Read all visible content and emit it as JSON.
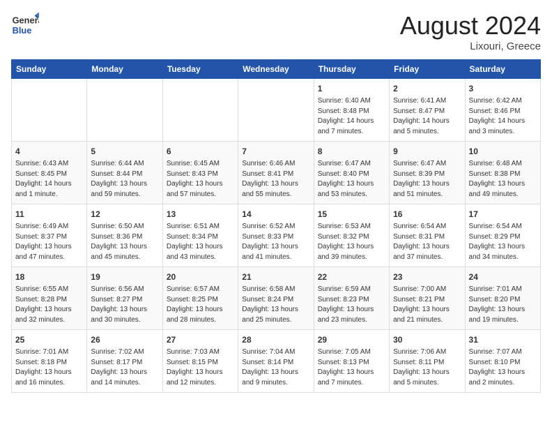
{
  "header": {
    "logo_general": "General",
    "logo_blue": "Blue",
    "month_year": "August 2024",
    "location": "Lixouri, Greece"
  },
  "weekdays": [
    "Sunday",
    "Monday",
    "Tuesday",
    "Wednesday",
    "Thursday",
    "Friday",
    "Saturday"
  ],
  "weeks": [
    [
      {
        "day": "",
        "info": ""
      },
      {
        "day": "",
        "info": ""
      },
      {
        "day": "",
        "info": ""
      },
      {
        "day": "",
        "info": ""
      },
      {
        "day": "1",
        "info": "Sunrise: 6:40 AM\nSunset: 8:48 PM\nDaylight: 14 hours\nand 7 minutes."
      },
      {
        "day": "2",
        "info": "Sunrise: 6:41 AM\nSunset: 8:47 PM\nDaylight: 14 hours\nand 5 minutes."
      },
      {
        "day": "3",
        "info": "Sunrise: 6:42 AM\nSunset: 8:46 PM\nDaylight: 14 hours\nand 3 minutes."
      }
    ],
    [
      {
        "day": "4",
        "info": "Sunrise: 6:43 AM\nSunset: 8:45 PM\nDaylight: 14 hours\nand 1 minute."
      },
      {
        "day": "5",
        "info": "Sunrise: 6:44 AM\nSunset: 8:44 PM\nDaylight: 13 hours\nand 59 minutes."
      },
      {
        "day": "6",
        "info": "Sunrise: 6:45 AM\nSunset: 8:43 PM\nDaylight: 13 hours\nand 57 minutes."
      },
      {
        "day": "7",
        "info": "Sunrise: 6:46 AM\nSunset: 8:41 PM\nDaylight: 13 hours\nand 55 minutes."
      },
      {
        "day": "8",
        "info": "Sunrise: 6:47 AM\nSunset: 8:40 PM\nDaylight: 13 hours\nand 53 minutes."
      },
      {
        "day": "9",
        "info": "Sunrise: 6:47 AM\nSunset: 8:39 PM\nDaylight: 13 hours\nand 51 minutes."
      },
      {
        "day": "10",
        "info": "Sunrise: 6:48 AM\nSunset: 8:38 PM\nDaylight: 13 hours\nand 49 minutes."
      }
    ],
    [
      {
        "day": "11",
        "info": "Sunrise: 6:49 AM\nSunset: 8:37 PM\nDaylight: 13 hours\nand 47 minutes."
      },
      {
        "day": "12",
        "info": "Sunrise: 6:50 AM\nSunset: 8:36 PM\nDaylight: 13 hours\nand 45 minutes."
      },
      {
        "day": "13",
        "info": "Sunrise: 6:51 AM\nSunset: 8:34 PM\nDaylight: 13 hours\nand 43 minutes."
      },
      {
        "day": "14",
        "info": "Sunrise: 6:52 AM\nSunset: 8:33 PM\nDaylight: 13 hours\nand 41 minutes."
      },
      {
        "day": "15",
        "info": "Sunrise: 6:53 AM\nSunset: 8:32 PM\nDaylight: 13 hours\nand 39 minutes."
      },
      {
        "day": "16",
        "info": "Sunrise: 6:54 AM\nSunset: 8:31 PM\nDaylight: 13 hours\nand 37 minutes."
      },
      {
        "day": "17",
        "info": "Sunrise: 6:54 AM\nSunset: 8:29 PM\nDaylight: 13 hours\nand 34 minutes."
      }
    ],
    [
      {
        "day": "18",
        "info": "Sunrise: 6:55 AM\nSunset: 8:28 PM\nDaylight: 13 hours\nand 32 minutes."
      },
      {
        "day": "19",
        "info": "Sunrise: 6:56 AM\nSunset: 8:27 PM\nDaylight: 13 hours\nand 30 minutes."
      },
      {
        "day": "20",
        "info": "Sunrise: 6:57 AM\nSunset: 8:25 PM\nDaylight: 13 hours\nand 28 minutes."
      },
      {
        "day": "21",
        "info": "Sunrise: 6:58 AM\nSunset: 8:24 PM\nDaylight: 13 hours\nand 25 minutes."
      },
      {
        "day": "22",
        "info": "Sunrise: 6:59 AM\nSunset: 8:23 PM\nDaylight: 13 hours\nand 23 minutes."
      },
      {
        "day": "23",
        "info": "Sunrise: 7:00 AM\nSunset: 8:21 PM\nDaylight: 13 hours\nand 21 minutes."
      },
      {
        "day": "24",
        "info": "Sunrise: 7:01 AM\nSunset: 8:20 PM\nDaylight: 13 hours\nand 19 minutes."
      }
    ],
    [
      {
        "day": "25",
        "info": "Sunrise: 7:01 AM\nSunset: 8:18 PM\nDaylight: 13 hours\nand 16 minutes."
      },
      {
        "day": "26",
        "info": "Sunrise: 7:02 AM\nSunset: 8:17 PM\nDaylight: 13 hours\nand 14 minutes."
      },
      {
        "day": "27",
        "info": "Sunrise: 7:03 AM\nSunset: 8:15 PM\nDaylight: 13 hours\nand 12 minutes."
      },
      {
        "day": "28",
        "info": "Sunrise: 7:04 AM\nSunset: 8:14 PM\nDaylight: 13 hours\nand 9 minutes."
      },
      {
        "day": "29",
        "info": "Sunrise: 7:05 AM\nSunset: 8:13 PM\nDaylight: 13 hours\nand 7 minutes."
      },
      {
        "day": "30",
        "info": "Sunrise: 7:06 AM\nSunset: 8:11 PM\nDaylight: 13 hours\nand 5 minutes."
      },
      {
        "day": "31",
        "info": "Sunrise: 7:07 AM\nSunset: 8:10 PM\nDaylight: 13 hours\nand 2 minutes."
      }
    ]
  ]
}
